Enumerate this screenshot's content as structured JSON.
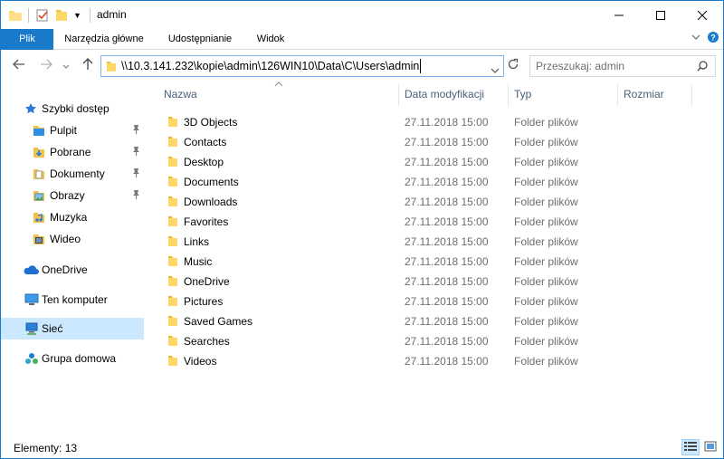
{
  "window": {
    "title": "admin",
    "accent": "#1979ca"
  },
  "titlebar": {
    "quick_access_icons": [
      "folder-icon",
      "properties-icon",
      "new-folder-icon",
      "customize-dropdown-icon"
    ],
    "controls": [
      "minimize-icon",
      "maximize-icon",
      "close-icon"
    ]
  },
  "ribbon": {
    "tabs": [
      {
        "label": "Plik",
        "active": true
      },
      {
        "label": "Narzędzia główne"
      },
      {
        "label": "Udostępnianie"
      },
      {
        "label": "Widok"
      }
    ]
  },
  "navigation": {
    "address": "\\\\10.3.141.232\\kopie\\admin\\126WIN10\\Data\\C\\Users\\admin",
    "search_placeholder": "Przeszukaj: admin"
  },
  "sidebar": {
    "quick_access": "Szybki dostęp",
    "pinned": [
      {
        "label": "Pulpit",
        "icon": "desktop-icon",
        "pinned": true
      },
      {
        "label": "Pobrane",
        "icon": "downloads-icon",
        "pinned": true
      },
      {
        "label": "Dokumenty",
        "icon": "documents-icon",
        "pinned": true
      },
      {
        "label": "Obrazy",
        "icon": "pictures-icon",
        "pinned": true
      },
      {
        "label": "Muzyka",
        "icon": "music-icon",
        "pinned": false
      },
      {
        "label": "Wideo",
        "icon": "video-icon",
        "pinned": false
      }
    ],
    "onedrive": "OneDrive",
    "this_pc": "Ten komputer",
    "network": "Sieć",
    "homegroup": "Grupa domowa"
  },
  "list": {
    "columns": {
      "name": "Nazwa",
      "modified": "Data modyfikacji",
      "type": "Typ",
      "size": "Rozmiar"
    },
    "rows": [
      {
        "name": "3D Objects",
        "modified": "27.11.2018 15:00",
        "type": "Folder plików"
      },
      {
        "name": "Contacts",
        "modified": "27.11.2018 15:00",
        "type": "Folder plików"
      },
      {
        "name": "Desktop",
        "modified": "27.11.2018 15:00",
        "type": "Folder plików"
      },
      {
        "name": "Documents",
        "modified": "27.11.2018 15:00",
        "type": "Folder plików"
      },
      {
        "name": "Downloads",
        "modified": "27.11.2018 15:00",
        "type": "Folder plików"
      },
      {
        "name": "Favorites",
        "modified": "27.11.2018 15:00",
        "type": "Folder plików"
      },
      {
        "name": "Links",
        "modified": "27.11.2018 15:00",
        "type": "Folder plików"
      },
      {
        "name": "Music",
        "modified": "27.11.2018 15:00",
        "type": "Folder plików"
      },
      {
        "name": "OneDrive",
        "modified": "27.11.2018 15:00",
        "type": "Folder plików"
      },
      {
        "name": "Pictures",
        "modified": "27.11.2018 15:00",
        "type": "Folder plików"
      },
      {
        "name": "Saved Games",
        "modified": "27.11.2018 15:00",
        "type": "Folder plików"
      },
      {
        "name": "Searches",
        "modified": "27.11.2018 15:00",
        "type": "Folder plików"
      },
      {
        "name": "Videos",
        "modified": "27.11.2018 15:00",
        "type": "Folder plików"
      }
    ]
  },
  "status": {
    "items_count": "Elementy: 13"
  }
}
